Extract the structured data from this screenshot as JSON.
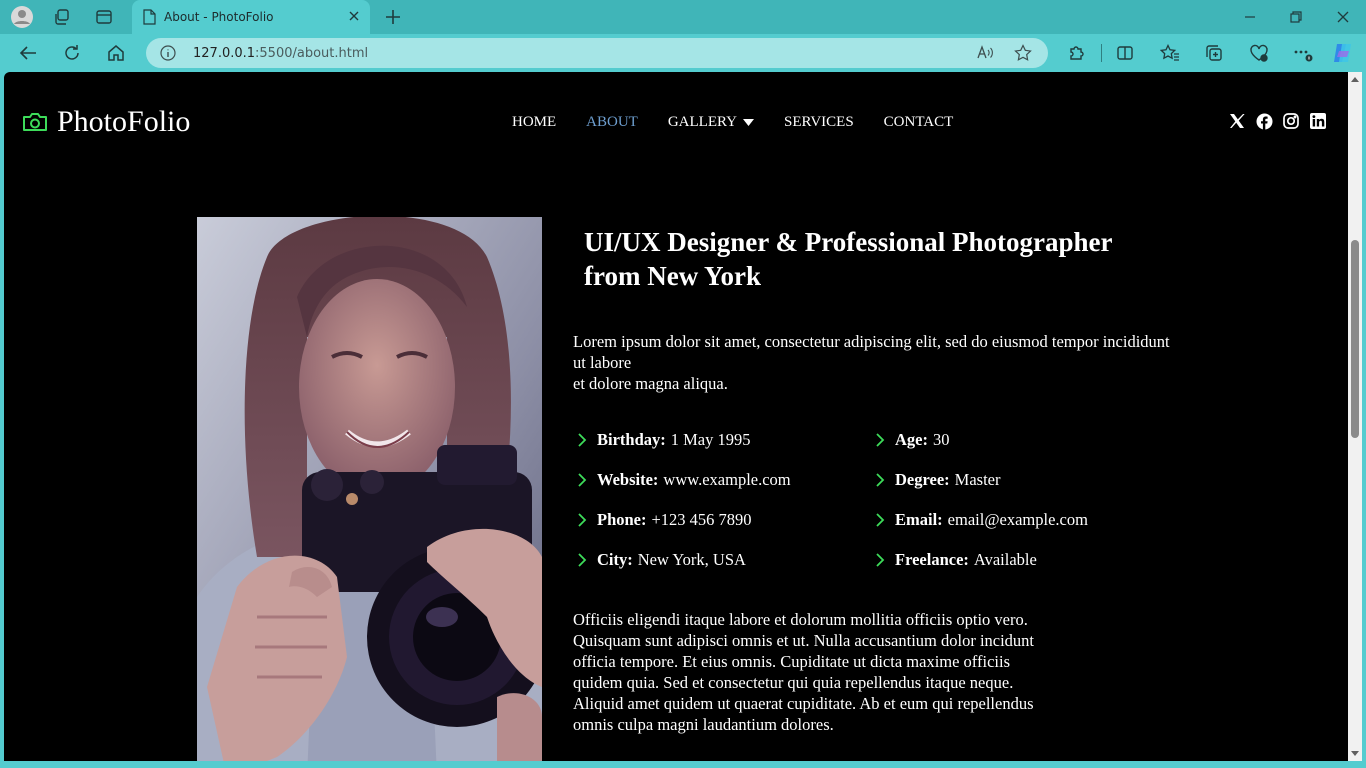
{
  "browser": {
    "tab_title": "About - PhotoFolio",
    "url_host": "127.0.0.1",
    "url_rest": ":5500/about.html"
  },
  "site": {
    "brand": "PhotoFolio",
    "accent_color": "#3ddc5a",
    "active_link_color": "#6e9fd0",
    "nav": [
      {
        "label": "HOME"
      },
      {
        "label": "ABOUT"
      },
      {
        "label": "GALLERY"
      },
      {
        "label": "SERVICES"
      },
      {
        "label": "CONTACT"
      }
    ],
    "social_icons": [
      "x-icon",
      "facebook-icon",
      "instagram-icon",
      "linkedin-icon"
    ]
  },
  "about": {
    "headline_line1": "UI/UX Designer & Professional Photographer",
    "headline_line2": "from New York",
    "intro_line1": "Lorem ipsum dolor sit amet, consectetur adipiscing elit, sed do eiusmod tempor incididunt ut labore",
    "intro_line2": "et dolore magna aliqua.",
    "facts": [
      {
        "label": "Birthday:",
        "value": "1 May 1995"
      },
      {
        "label": "Age:",
        "value": "30"
      },
      {
        "label": "Website:",
        "value": "www.example.com"
      },
      {
        "label": "Degree:",
        "value": "Master"
      },
      {
        "label": "Phone:",
        "value": "+123 456 7890"
      },
      {
        "label": "Email:",
        "value": "email@example.com"
      },
      {
        "label": "City:",
        "value": "New York, USA"
      },
      {
        "label": "Freelance:",
        "value": "Available"
      }
    ],
    "body": "Officiis eligendi itaque labore et dolorum mollitia officiis optio vero. Quisquam sunt adipisci omnis et ut. Nulla accusantium dolor incidunt officia tempore. Et eius omnis. Cupiditate ut dicta maxime officiis quidem quia. Sed et consectetur qui quia repellendus itaque neque. Aliquid amet quidem ut quaerat cupiditate. Ab et eum qui repellendus omnis culpa magni laudantium dolores."
  }
}
